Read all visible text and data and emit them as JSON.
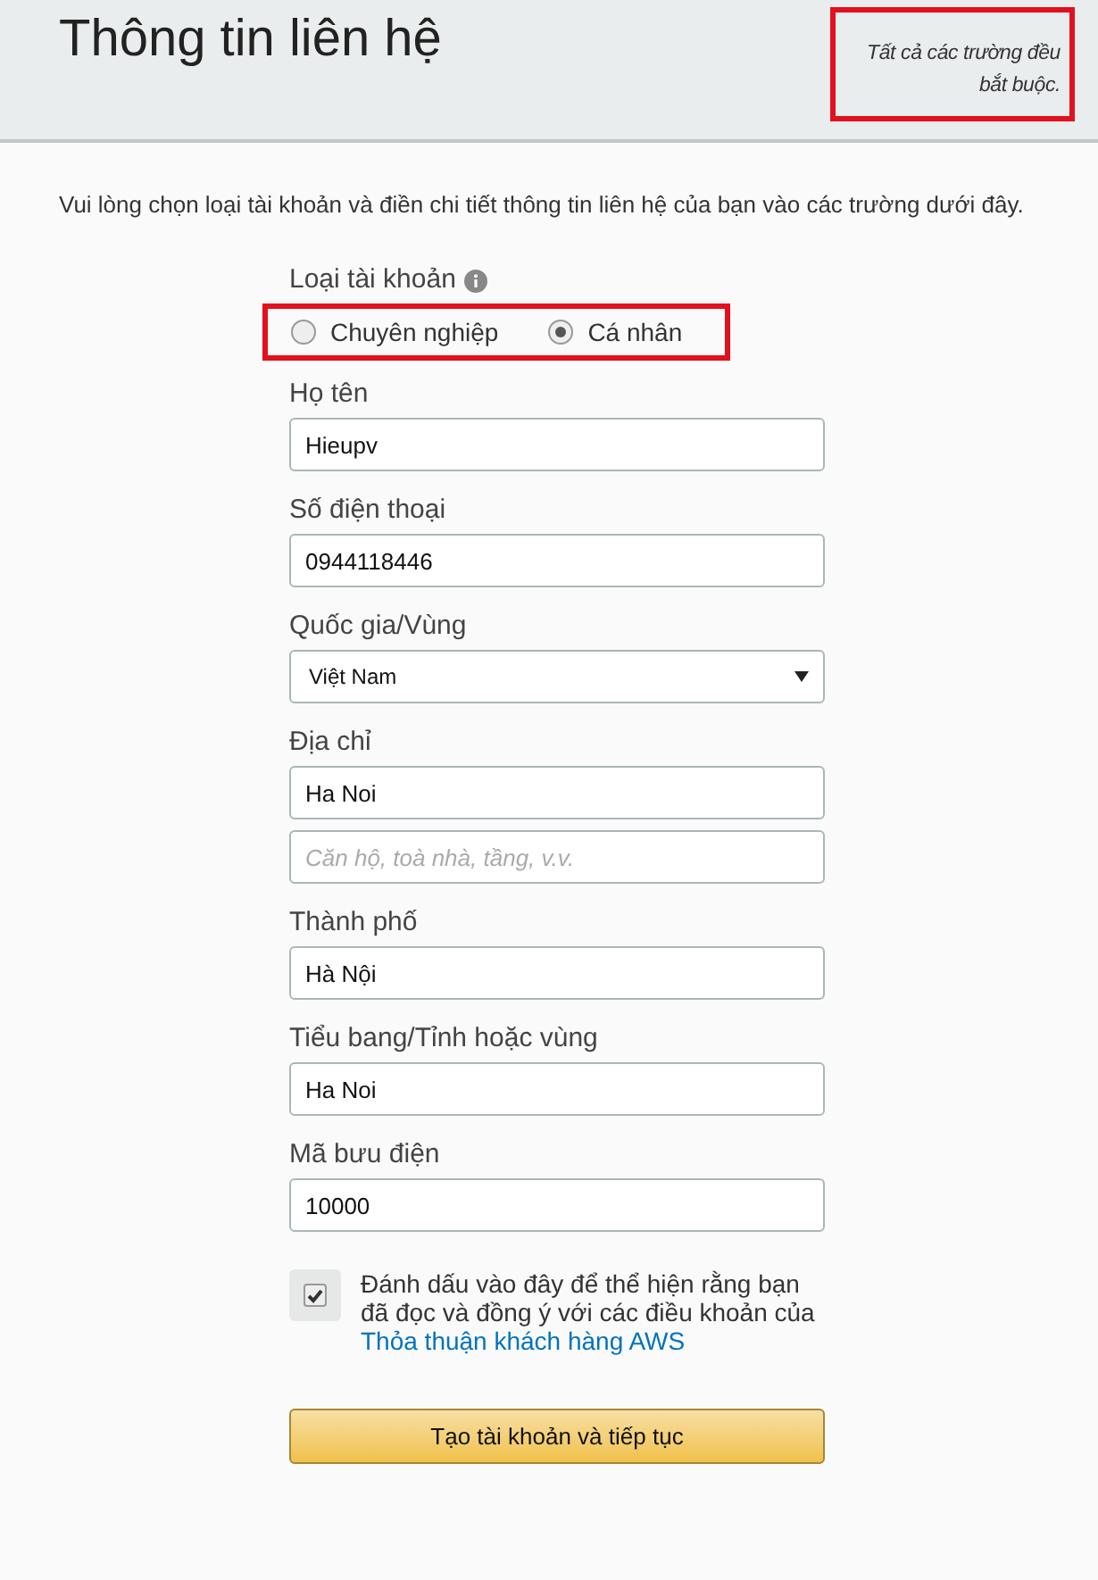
{
  "header": {
    "title": "Thông tin liên hệ",
    "note": "Tất cả các trường đều bắt buộc."
  },
  "intro": "Vui lòng chọn loại tài khoản và điền chi tiết thông tin liên hệ của bạn vào các trường dưới đây.",
  "account_type": {
    "label": "Loại tài khoản",
    "options": [
      {
        "label": "Chuyên nghiệp",
        "selected": false
      },
      {
        "label": "Cá nhân",
        "selected": true
      }
    ]
  },
  "fields": [
    {
      "kind": "text",
      "label": "Họ tên",
      "inputs": [
        {
          "value": "Hieupv"
        }
      ]
    },
    {
      "kind": "text",
      "label": "Số điện thoại",
      "inputs": [
        {
          "value": "0944118446"
        }
      ]
    },
    {
      "kind": "select",
      "label": "Quốc gia/Vùng",
      "inputs": [
        {
          "value": "Việt Nam"
        }
      ]
    },
    {
      "kind": "text",
      "label": "Địa chỉ",
      "inputs": [
        {
          "value": "Ha Noi"
        },
        {
          "placeholder": "Căn hộ, toà nhà, tầng, v.v."
        }
      ]
    },
    {
      "kind": "text",
      "label": "Thành phố",
      "inputs": [
        {
          "value": "Hà Nội"
        }
      ]
    },
    {
      "kind": "text",
      "label": "Tiểu bang/Tỉnh hoặc vùng",
      "inputs": [
        {
          "value": "Ha Noi"
        }
      ]
    },
    {
      "kind": "text",
      "label": "Mã bưu điện",
      "inputs": [
        {
          "value": "10000"
        }
      ]
    }
  ],
  "agreement": {
    "checked": true,
    "text": "Đánh dấu vào đây để thể hiện rằng bạn đã đọc và đồng ý với các điều khoản của",
    "link": "Thỏa thuận khách hàng AWS"
  },
  "submit": "Tạo tài khoản và tiếp tục"
}
